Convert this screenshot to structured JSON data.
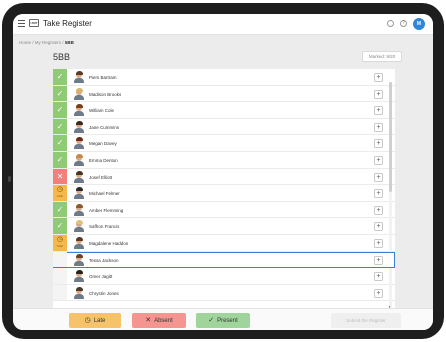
{
  "app": {
    "title": "Take Register",
    "logo_text": "UNIT",
    "avatar_initials": "M",
    "help_glyph": "?"
  },
  "breadcrumb": {
    "home": "Home",
    "sep1": " / ",
    "registers": "My Registers",
    "sep2": " / ",
    "current": "5BB"
  },
  "header": {
    "class_name": "5BB",
    "marked_badge": "Marked: 9/20"
  },
  "students": [
    {
      "name": "Piers Bartram",
      "status": "present",
      "hair": "#5b3b23"
    },
    {
      "name": "Madison Brooks",
      "status": "present",
      "hair": "#d9b46b"
    },
    {
      "name": "William Cole",
      "status": "present",
      "hair": "#7a3b18"
    },
    {
      "name": "Jane Cummins",
      "status": "present",
      "hair": "#3a2a1d"
    },
    {
      "name": "Megan Davey",
      "status": "present",
      "hair": "#6a2a1a"
    },
    {
      "name": "Emma Denton",
      "status": "present",
      "hair": "#c48a4a"
    },
    {
      "name": "Josef Elliott",
      "status": "absent",
      "hair": "#4a3421"
    },
    {
      "name": "Michael Felmer",
      "status": "late",
      "late_label": "2 min",
      "hair": "#2a2a2a"
    },
    {
      "name": "Amber Flemming",
      "status": "present",
      "hair": "#8a5a2a"
    },
    {
      "name": "Saffron Francis",
      "status": "present",
      "hair": "#e0c27a"
    },
    {
      "name": "Magdalene Haddon",
      "status": "late",
      "late_label": "5 min",
      "hair": "#5a3a25"
    },
    {
      "name": "Tessa Jackson",
      "status": "empty",
      "hair": "#6b4226",
      "selected": true
    },
    {
      "name": "Omer Jagitt",
      "status": "empty",
      "hair": "#2b1f18"
    },
    {
      "name": "Chrystin Jones",
      "status": "empty",
      "hair": "#4a3a2a"
    }
  ],
  "actions": {
    "late": "Late",
    "absent": "Absent",
    "present": "Present",
    "submit": "Submit the Register"
  },
  "colors": {
    "present": "#8fcb74",
    "absent": "#f27f7a",
    "late": "#f6b74d",
    "accent": "#3b7fd2"
  },
  "icons": {
    "present": "check-icon",
    "absent": "cross-icon",
    "late": "clock-icon",
    "add": "plus-icon"
  }
}
